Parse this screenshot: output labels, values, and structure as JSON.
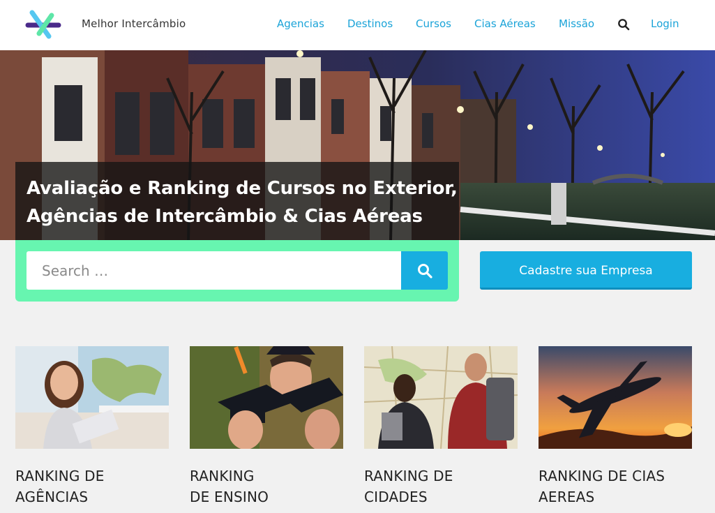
{
  "header": {
    "brand": "Melhor Intercâmbio",
    "nav": [
      "Agencias",
      "Destinos",
      "Cursos",
      "Cias Aéreas",
      "Missão"
    ],
    "login": "Login",
    "accent": "#1aa3d8"
  },
  "hero": {
    "title_line1": "Avaliação e Ranking de Cursos no Exterior,",
    "title_line2": "Agências de Intercâmbio & Cias Aéreas"
  },
  "search": {
    "placeholder": "Search …",
    "value": ""
  },
  "register_button": "Cadastre sua Empresa",
  "cards": [
    {
      "line1": "RANKING DE",
      "line2": "AGÊNCIAS"
    },
    {
      "line1": "RANKING",
      "line2": "DE ENSINO"
    },
    {
      "line1": "RANKING DE",
      "line2": "CIDADES"
    },
    {
      "line1": "RANKING DE CIAS",
      "line2": "AEREAS"
    }
  ],
  "colors": {
    "search_bg": "#67f5b0",
    "button": "#18aee0"
  }
}
